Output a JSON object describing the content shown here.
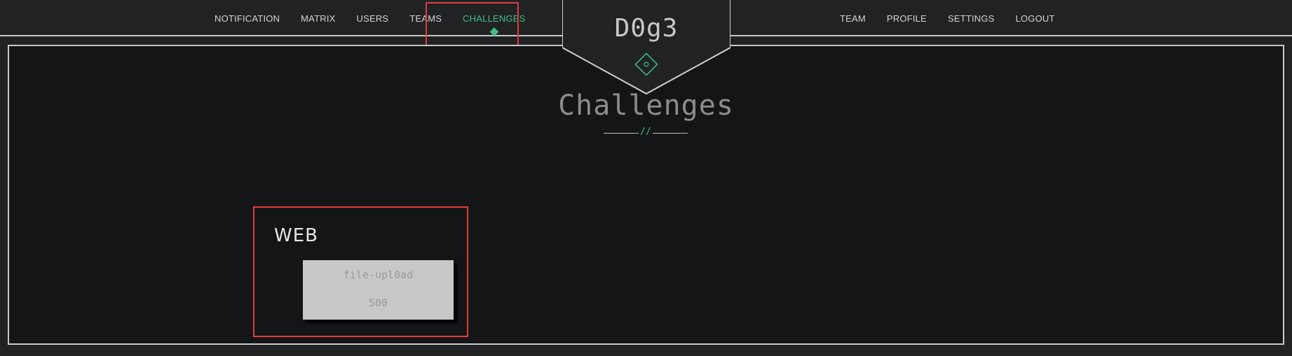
{
  "nav_left": [
    {
      "label": "NOTIFICATION"
    },
    {
      "label": "MATRIX"
    },
    {
      "label": "USERS"
    },
    {
      "label": "TEAMS"
    },
    {
      "label": "CHALLENGES",
      "active": true
    }
  ],
  "nav_right": [
    {
      "label": "TEAM"
    },
    {
      "label": "PROFILE"
    },
    {
      "label": "SETTINGS"
    },
    {
      "label": "LOGOUT"
    }
  ],
  "brand": {
    "name": "D0g3",
    "icon": "diamond-icon"
  },
  "page": {
    "title": "Challenges",
    "divider_mark": "//"
  },
  "categories": [
    {
      "title": "WEB",
      "challenges": [
        {
          "name": "file-upl0ad",
          "points": "500"
        }
      ]
    }
  ],
  "colors": {
    "accent": "#3fbf84",
    "highlight": "#e23b3b",
    "background": "#141517",
    "topbar": "#212224"
  }
}
